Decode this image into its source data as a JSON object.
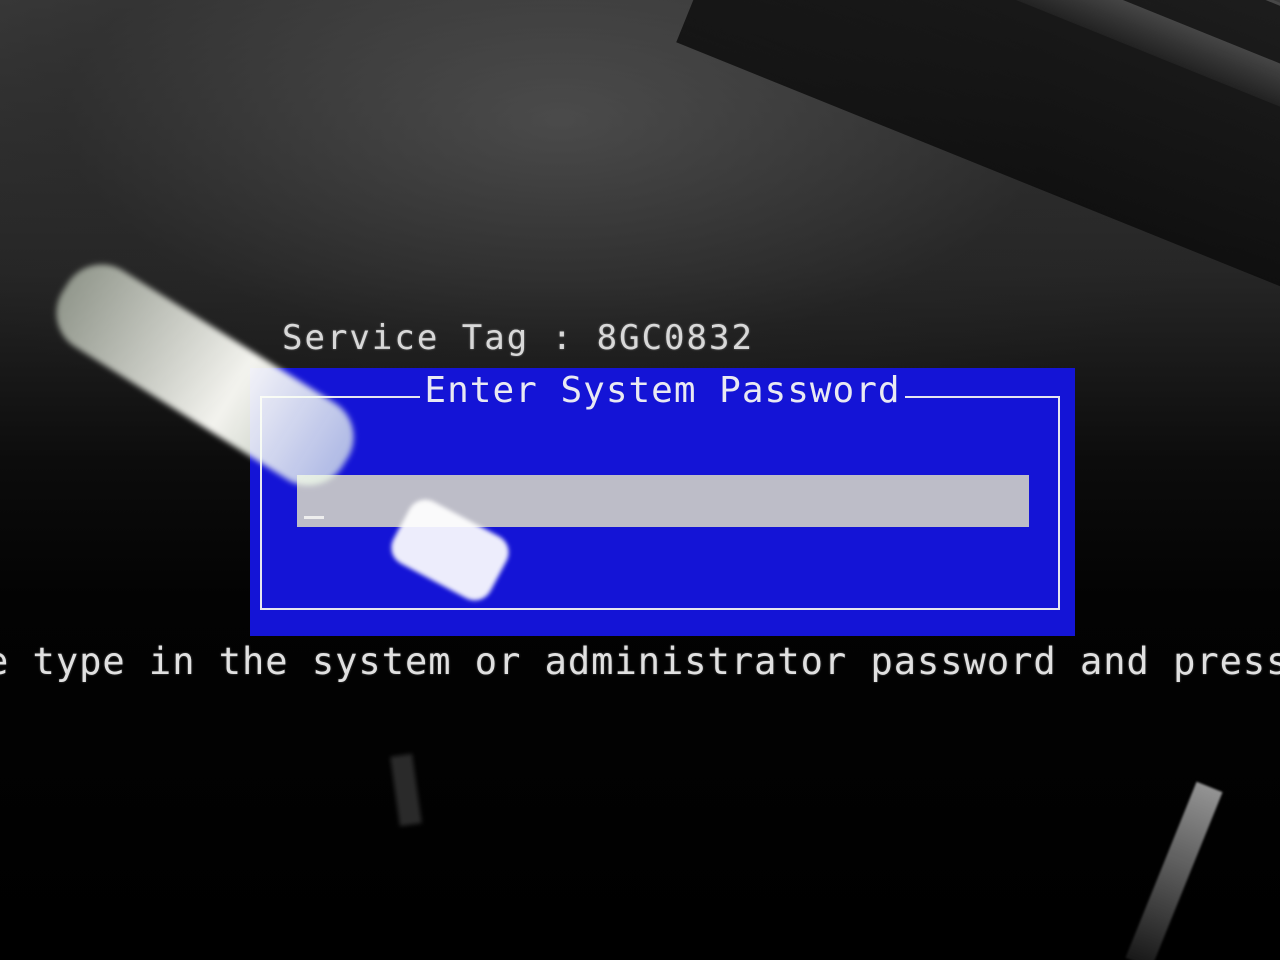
{
  "service_tag": {
    "label": "Service Tag",
    "separator": ":",
    "value": "8GC0832"
  },
  "password_dialog": {
    "title": "Enter System Password",
    "password_value": "",
    "background_color": "#1414d6",
    "field_color": "#bdbdc8"
  },
  "instructions": "e type in the system or administrator password and press ←"
}
